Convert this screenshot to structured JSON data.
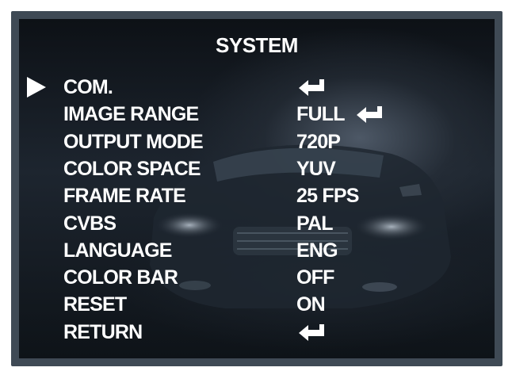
{
  "osd": {
    "title": "SYSTEM",
    "items": [
      {
        "label": "COM.",
        "value": "",
        "enter_icon": true,
        "selected": true
      },
      {
        "label": "IMAGE RANGE",
        "value": "FULL",
        "enter_icon": true,
        "selected": false
      },
      {
        "label": "OUTPUT MODE",
        "value": "720P",
        "enter_icon": false,
        "selected": false
      },
      {
        "label": "COLOR SPACE",
        "value": "YUV",
        "enter_icon": false,
        "selected": false
      },
      {
        "label": "FRAME RATE",
        "value": "25 FPS",
        "enter_icon": false,
        "selected": false
      },
      {
        "label": "CVBS",
        "value": "PAL",
        "enter_icon": false,
        "selected": false
      },
      {
        "label": "LANGUAGE",
        "value": "ENG",
        "enter_icon": false,
        "selected": false
      },
      {
        "label": "COLOR BAR",
        "value": "OFF",
        "enter_icon": false,
        "selected": false
      },
      {
        "label": "RESET",
        "value": "ON",
        "enter_icon": false,
        "selected": false
      },
      {
        "label": "RETURN",
        "value": "",
        "enter_icon": true,
        "selected": false
      }
    ],
    "icons": {
      "cursor": "triangle-right-icon",
      "enter": "enter-return-icon"
    },
    "colors": {
      "text": "#ffffff",
      "bezel": "#3f4a55",
      "background": "#12181f"
    }
  }
}
